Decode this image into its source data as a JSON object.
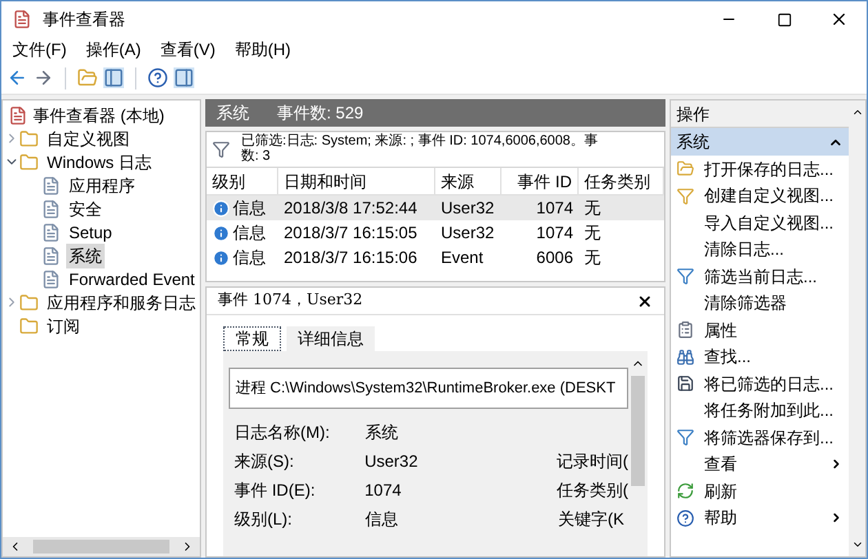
{
  "window": {
    "title": "事件查看器"
  },
  "menu": [
    "文件(F)",
    "操作(A)",
    "查看(V)",
    "帮助(H)"
  ],
  "tree": {
    "label": "事件查看器 (本地)",
    "children": [
      {
        "label": "自定义视图",
        "expanded": false,
        "selected": false
      },
      {
        "label": "Windows 日志",
        "expanded": true,
        "selected": false,
        "children": [
          {
            "label": "应用程序",
            "selected": false
          },
          {
            "label": "安全",
            "selected": false
          },
          {
            "label": "Setup",
            "selected": false
          },
          {
            "label": "系统",
            "selected": true
          },
          {
            "label": "Forwarded Event",
            "selected": false
          }
        ]
      },
      {
        "label": "应用程序和服务日志",
        "expanded": false,
        "selected": false
      },
      {
        "label": "订阅",
        "selected": false
      }
    ]
  },
  "log_header": {
    "name": "系统",
    "count": "事件数: 529"
  },
  "filter": {
    "line1": "已筛选:日志: System; 来源: ; 事件 ID: 1074,6006,6008。事",
    "line2": "数: 3"
  },
  "table": {
    "columns": [
      "级别",
      "日期和时间",
      "来源",
      "事件 ID",
      "任务类别"
    ],
    "rows": [
      {
        "level": "信息",
        "date": "2018/3/8 17:52:44",
        "source": "User32",
        "id": "1074",
        "task": "无",
        "selected": true
      },
      {
        "level": "信息",
        "date": "2018/3/7 16:15:05",
        "source": "User32",
        "id": "1074",
        "task": "无",
        "selected": false
      },
      {
        "level": "信息",
        "date": "2018/3/7 16:15:06",
        "source": "Event",
        "id": "6006",
        "task": "无",
        "selected": false
      }
    ]
  },
  "detail": {
    "title": "事件 1074，User32",
    "tabs": [
      {
        "label": "常规",
        "selected": true
      },
      {
        "label": "详细信息",
        "selected": false
      }
    ],
    "message": "进程 C:\\Windows\\System32\\RuntimeBroker.exe (DESKT",
    "fields": [
      {
        "label": "日志名称(M):",
        "value": "系统"
      },
      {
        "label": "来源(S):",
        "value": "User32",
        "label_2": "记录时间("
      },
      {
        "label": "事件 ID(E):",
        "value": "1074",
        "label_2": "任务类别("
      },
      {
        "label": "级别(L):",
        "value": "信息",
        "label_2": "关键字(K"
      }
    ]
  },
  "actions": {
    "title": "操作",
    "group": {
      "label": "系统",
      "expanded": true
    },
    "items": [
      {
        "label": "打开保存的日志...",
        "kind": "item"
      },
      {
        "label": "创建自定义视图...",
        "kind": "item"
      },
      {
        "label": "导入自定义视图...",
        "kind": "item"
      },
      {
        "label": "清除日志...",
        "kind": "item"
      },
      {
        "label": "筛选当前日志...",
        "kind": "item"
      },
      {
        "label": "清除筛选器",
        "kind": "item"
      },
      {
        "label": "属性",
        "kind": "item"
      },
      {
        "label": "查找...",
        "kind": "item"
      },
      {
        "label": "将已筛选的日志...",
        "kind": "item"
      },
      {
        "label": "将任务附加到此...",
        "kind": "item"
      },
      {
        "label": "将筛选器保存到...",
        "kind": "item"
      },
      {
        "label": "查看",
        "kind": "submenu"
      },
      {
        "label": "刷新",
        "kind": "item"
      },
      {
        "label": "帮助",
        "kind": "submenu"
      }
    ]
  }
}
